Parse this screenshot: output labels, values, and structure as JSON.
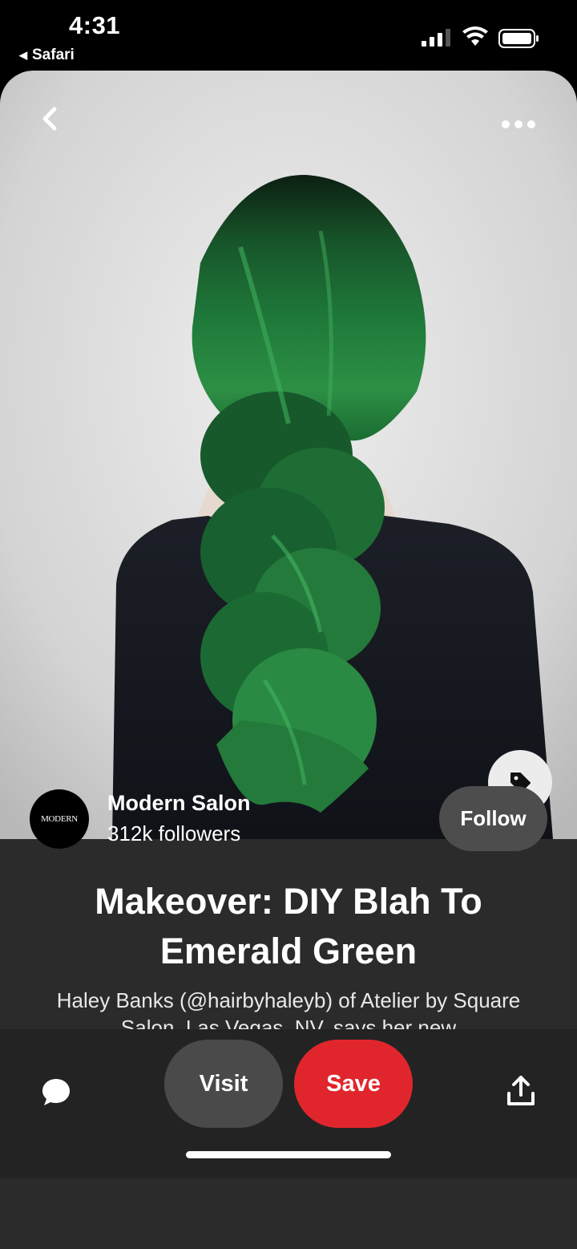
{
  "status_bar": {
    "time": "4:31",
    "back_app": "Safari",
    "back_arrow": "◀",
    "icons": [
      "cellular-signal-icon",
      "wifi-icon",
      "battery-icon"
    ]
  },
  "pin": {
    "image_description_icon": "green-braided-hair-photo",
    "creator": {
      "avatar_text": "MODERN",
      "name": "Modern Salon",
      "followers": "312k followers"
    },
    "follow_label": "Follow",
    "title": "Makeover: DIY Blah To Emerald Green",
    "description": "Haley Banks (@hairbyhaleyb) of Atelier by Square Salon, Las Vegas, NV, says her new"
  },
  "actions": {
    "visit_label": "Visit",
    "save_label": "Save"
  },
  "colors": {
    "save": "#e0262c",
    "card_background": "#2b2b2b",
    "button_grey": "#4a4a4a",
    "hair_green": "#1f7a3a"
  }
}
